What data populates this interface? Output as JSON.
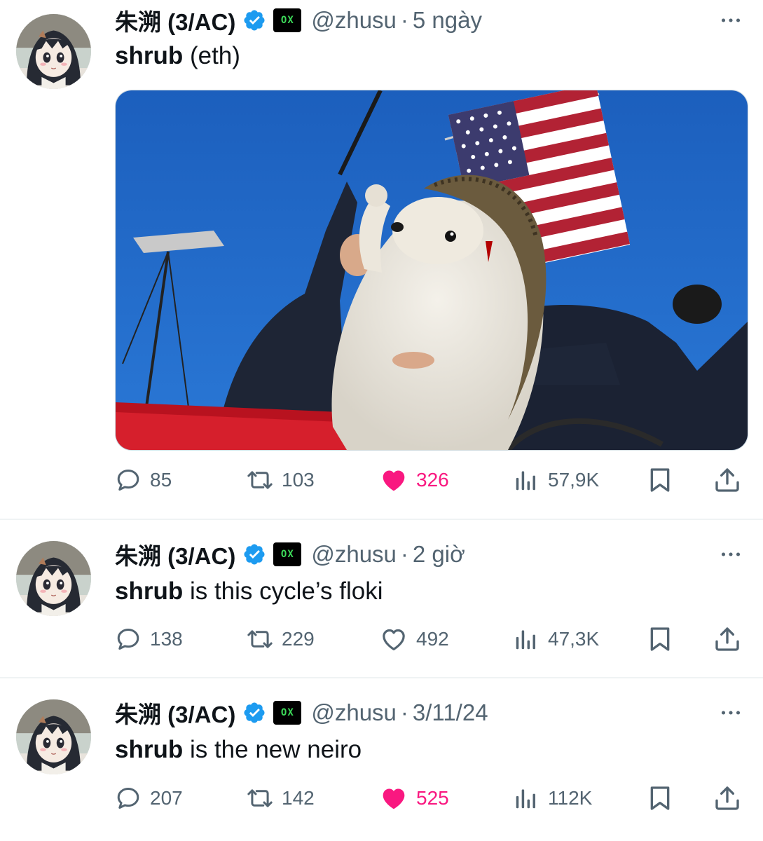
{
  "colors": {
    "like_pink": "#f91880",
    "verified_blue": "#1d9bf0",
    "muted_gray": "#536471",
    "text_black": "#0f1419"
  },
  "tweets": [
    {
      "name": "朱溯 (3/AC)",
      "org_badge": "OX",
      "handle": "@zhusu",
      "sep": "·",
      "time": "5 ngày",
      "text_bold": "shrub",
      "text_rest": " (eth)",
      "has_image": true,
      "image_alt": "Edited photo: a hedgehog with a raised fist in front of a US flag, with men in suits on a stage",
      "stats": {
        "replies": "85",
        "reposts": "103",
        "likes": "326",
        "views": "57,9K"
      },
      "liked": true
    },
    {
      "name": "朱溯 (3/AC)",
      "org_badge": "OX",
      "handle": "@zhusu",
      "sep": "·",
      "time": "2 giờ",
      "text_bold": "shrub",
      "text_rest": " is this cycle’s floki",
      "has_image": false,
      "stats": {
        "replies": "138",
        "reposts": "229",
        "likes": "492",
        "views": "47,3K"
      },
      "liked": false
    },
    {
      "name": "朱溯 (3/AC)",
      "org_badge": "OX",
      "handle": "@zhusu",
      "sep": "·",
      "time": "3/11/24",
      "text_bold": "shrub",
      "text_rest": " is the new neiro",
      "has_image": false,
      "stats": {
        "replies": "207",
        "reposts": "142",
        "likes": "525",
        "views": "112K"
      },
      "liked": true
    }
  ],
  "icons": {
    "reply": "reply-icon",
    "repost": "repost-icon",
    "like": "heart-icon",
    "views": "analytics-icon",
    "bookmark": "bookmark-icon",
    "share": "share-icon",
    "more": "more-icon",
    "verified": "verified-icon"
  }
}
